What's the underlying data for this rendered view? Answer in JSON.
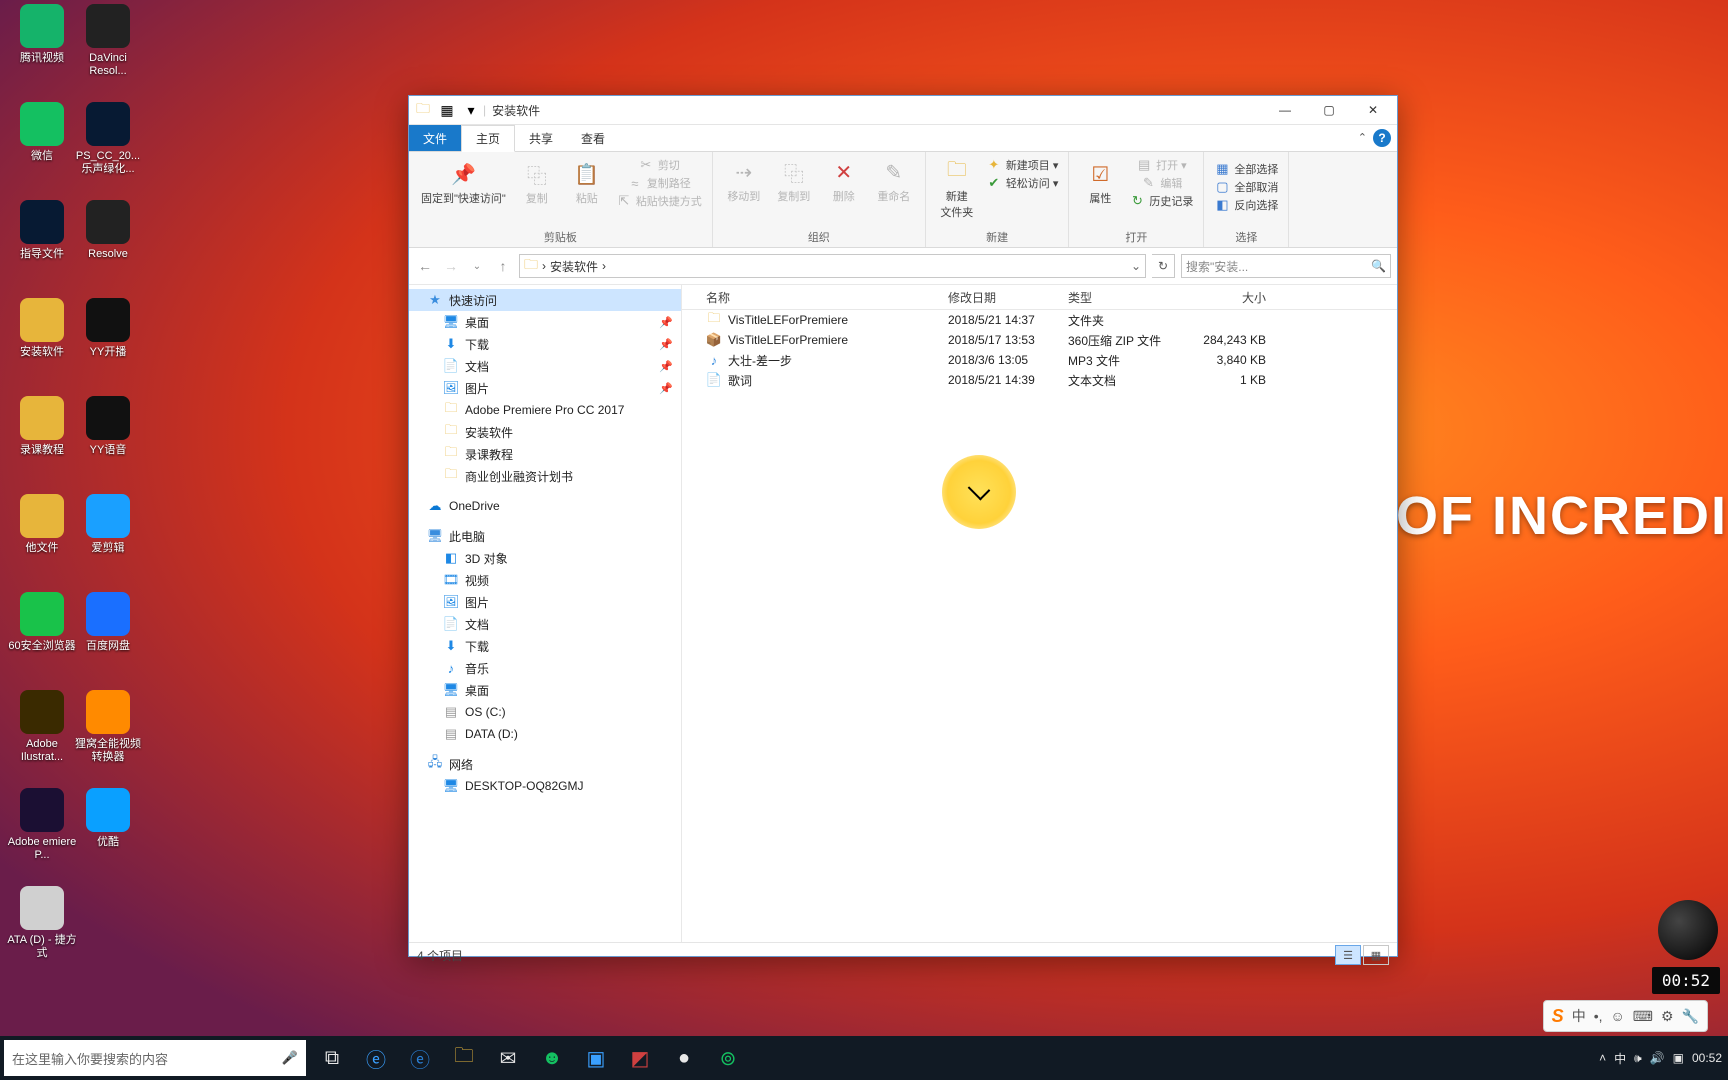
{
  "wallpaper_text": "SEARCH OF INCREDI",
  "desktop_icons": [
    {
      "label": "腾讯视频",
      "color": "#15b36a"
    },
    {
      "label": "DaVinci Resol...",
      "color": "#222"
    },
    {
      "label": "微信",
      "color": "#14c061"
    },
    {
      "label": "PS_CC_20... 乐声绿化...",
      "color": "#071a33"
    },
    {
      "label": "指导文件",
      "color": "#071a33"
    },
    {
      "label": "Resolve",
      "color": "#222"
    },
    {
      "label": "安装软件",
      "color": "#e7b53b"
    },
    {
      "label": "YY开播",
      "color": "#111"
    },
    {
      "label": "录课教程",
      "color": "#e7b53b"
    },
    {
      "label": "YY语音",
      "color": "#111"
    },
    {
      "label": "他文件",
      "color": "#e7b53b"
    },
    {
      "label": "爱剪辑",
      "color": "#1aa0ff"
    },
    {
      "label": "60安全浏览器",
      "color": "#19c24a"
    },
    {
      "label": "百度网盘",
      "color": "#1a6fff"
    },
    {
      "label": "Adobe Ilustrat...",
      "color": "#3a2a00"
    },
    {
      "label": "狸窝全能视频转换器",
      "color": "#ff8a00"
    },
    {
      "label": "Adobe emiere P...",
      "color": "#1b0f33"
    },
    {
      "label": "优酷",
      "color": "#0aa0ff"
    },
    {
      "label": "ATA (D) - 捷方式",
      "color": "#d0d0d0"
    }
  ],
  "window": {
    "title": "安装软件",
    "tabs": {
      "file": "文件",
      "home": "主页",
      "share": "共享",
      "view": "查看"
    },
    "ribbon": {
      "clipboard": {
        "pin": "固定到\"快速访问\"",
        "copy": "复制",
        "paste": "粘贴",
        "cut": "剪切",
        "copypath": "复制路径",
        "pastesc": "粘贴快捷方式",
        "group": "剪贴板"
      },
      "org": {
        "moveto": "移动到",
        "copyto": "复制到",
        "delete": "删除",
        "rename": "重命名",
        "group": "组织"
      },
      "new": {
        "newfolder": "新建\n文件夹",
        "newitem": "新建项目 ▾",
        "easyaccess": "轻松访问 ▾",
        "group": "新建"
      },
      "open": {
        "props": "属性",
        "open": "打开 ▾",
        "edit": "编辑",
        "history": "历史记录",
        "group": "打开"
      },
      "select": {
        "all": "全部选择",
        "none": "全部取消",
        "invert": "反向选择",
        "group": "选择"
      }
    },
    "breadcrumb": {
      "root": "›",
      "folder": "安装软件",
      "sep": "›"
    },
    "search_placeholder": "搜索\"安装...",
    "columns": {
      "name": "名称",
      "date": "修改日期",
      "type": "类型",
      "size": "大小"
    },
    "files": [
      {
        "icon": "folder",
        "name": "VisTitleLEForPremiere",
        "date": "2018/5/21 14:37",
        "type": "文件夹",
        "size": ""
      },
      {
        "icon": "zip",
        "name": "VisTitleLEForPremiere",
        "date": "2018/5/17 13:53",
        "type": "360压缩 ZIP 文件",
        "size": "284,243 KB"
      },
      {
        "icon": "mp3",
        "name": "大壮-差一步",
        "date": "2018/3/6 13:05",
        "type": "MP3 文件",
        "size": "3,840 KB"
      },
      {
        "icon": "txt",
        "name": "歌词",
        "date": "2018/5/21 14:39",
        "type": "文本文档",
        "size": "1 KB"
      }
    ],
    "status": "4 个项目"
  },
  "sidebar": {
    "quick": "快速访问",
    "quick_items": [
      {
        "icon": "desktop",
        "label": "桌面",
        "pin": true,
        "color": "#1e88e5"
      },
      {
        "icon": "down",
        "label": "下载",
        "pin": true,
        "color": "#1e88e5"
      },
      {
        "icon": "doc",
        "label": "文档",
        "pin": true,
        "color": "#1e88e5"
      },
      {
        "icon": "pic",
        "label": "图片",
        "pin": true,
        "color": "#1e88e5"
      },
      {
        "icon": "folder",
        "label": "Adobe Premiere Pro CC 2017",
        "color": "#e7b53b"
      },
      {
        "icon": "folder",
        "label": "安装软件",
        "color": "#e7b53b"
      },
      {
        "icon": "folder",
        "label": "录课教程",
        "color": "#e7b53b"
      },
      {
        "icon": "folder",
        "label": "商业创业融资计划书",
        "color": "#e7b53b"
      }
    ],
    "onedrive": "OneDrive",
    "thispc": "此电脑",
    "pc_items": [
      {
        "icon": "3d",
        "label": "3D 对象",
        "color": "#1e88e5"
      },
      {
        "icon": "video",
        "label": "视频",
        "color": "#1e88e5"
      },
      {
        "icon": "pic",
        "label": "图片",
        "color": "#1e88e5"
      },
      {
        "icon": "doc",
        "label": "文档",
        "color": "#1e88e5"
      },
      {
        "icon": "down",
        "label": "下载",
        "color": "#1e88e5"
      },
      {
        "icon": "music",
        "label": "音乐",
        "color": "#1e88e5"
      },
      {
        "icon": "desktop",
        "label": "桌面",
        "color": "#1e88e5"
      },
      {
        "icon": "drive",
        "label": "OS (C:)",
        "color": "#999"
      },
      {
        "icon": "drive",
        "label": "DATA (D:)",
        "color": "#999"
      }
    ],
    "network": "网络",
    "net_items": [
      {
        "icon": "pc",
        "label": "DESKTOP-OQ82GMJ",
        "color": "#1e88e5"
      }
    ]
  },
  "taskbar": {
    "search_placeholder": "在这里输入你要搜索的内容",
    "clock": "00:52",
    "tray_cn": "中"
  },
  "ime": {
    "s": "S",
    "cn": "中"
  },
  "duration": "00:52"
}
